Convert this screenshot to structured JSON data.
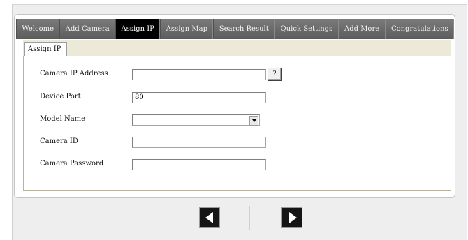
{
  "wizard": {
    "steps": [
      {
        "label": "Welcome",
        "active": false
      },
      {
        "label": "Add Camera",
        "active": false
      },
      {
        "label": "Assign IP",
        "active": true
      },
      {
        "label": "Assign Map",
        "active": false
      },
      {
        "label": "Search Result",
        "active": false
      },
      {
        "label": "Quick Settings",
        "active": false
      },
      {
        "label": "Add More",
        "active": false
      },
      {
        "label": "Congratulations",
        "active": false
      }
    ]
  },
  "subtab": {
    "label": "Assign IP"
  },
  "form": {
    "camera_ip_address": {
      "label": "Camera IP Address",
      "value": "",
      "help_label": "?"
    },
    "device_port": {
      "label": "Device Port",
      "value": "80"
    },
    "model_name": {
      "label": "Model Name",
      "value": ""
    },
    "camera_id": {
      "label": "Camera ID",
      "value": ""
    },
    "camera_password": {
      "label": "Camera Password",
      "value": ""
    }
  },
  "navigation": {
    "back_icon": "triangle-left-icon",
    "next_icon": "triangle-right-icon"
  },
  "colors": {
    "tab_bg": "#6b6b6b",
    "tab_active_bg": "#000000",
    "subtab_bar_bg": "#ece9d8",
    "nav_button_bg": "#151515"
  }
}
